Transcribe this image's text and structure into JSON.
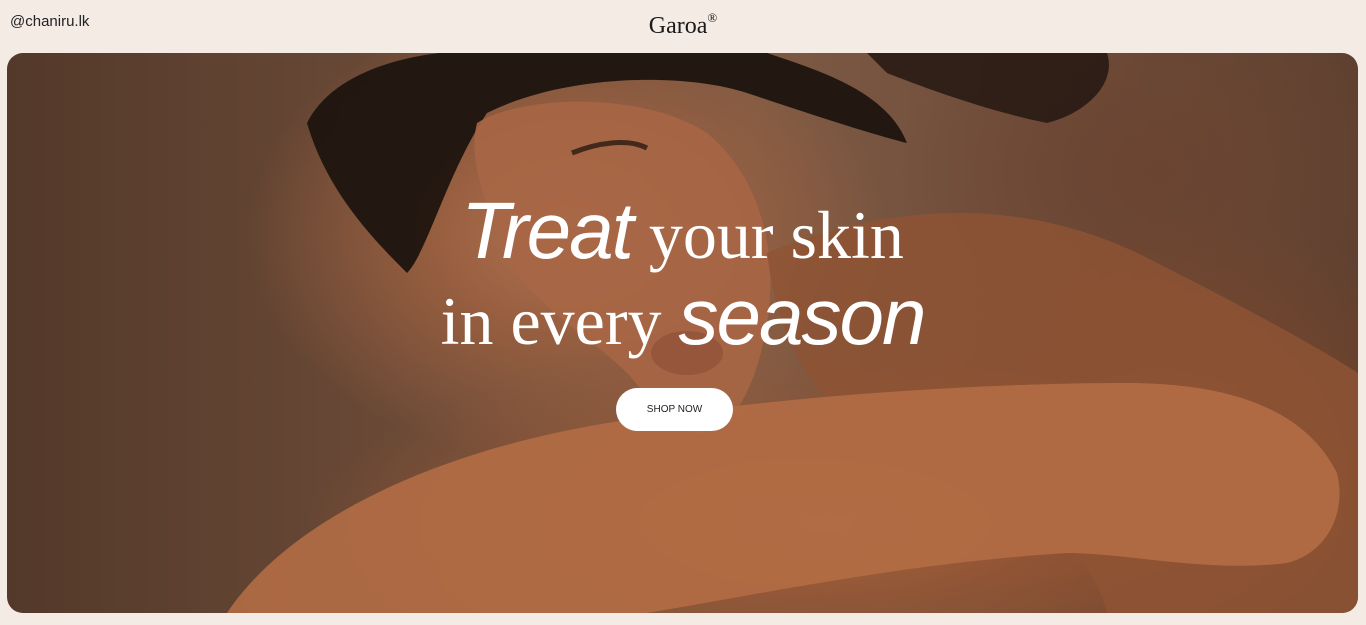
{
  "header": {
    "handle": "@chaniru.lk",
    "brand": "Garoa",
    "brand_mark": "®"
  },
  "hero": {
    "headline_line1_italic": "Treat",
    "headline_line1_rest": " your skin",
    "headline_line2_start": "in every ",
    "headline_line2_italic": "season",
    "cta_label": "SHOP NOW",
    "image_subject": "model-portrait-photo"
  },
  "colors": {
    "page_background": "#f4ebe5",
    "hero_text": "#ffffff",
    "button_background": "#ffffff",
    "button_text": "#222222"
  }
}
